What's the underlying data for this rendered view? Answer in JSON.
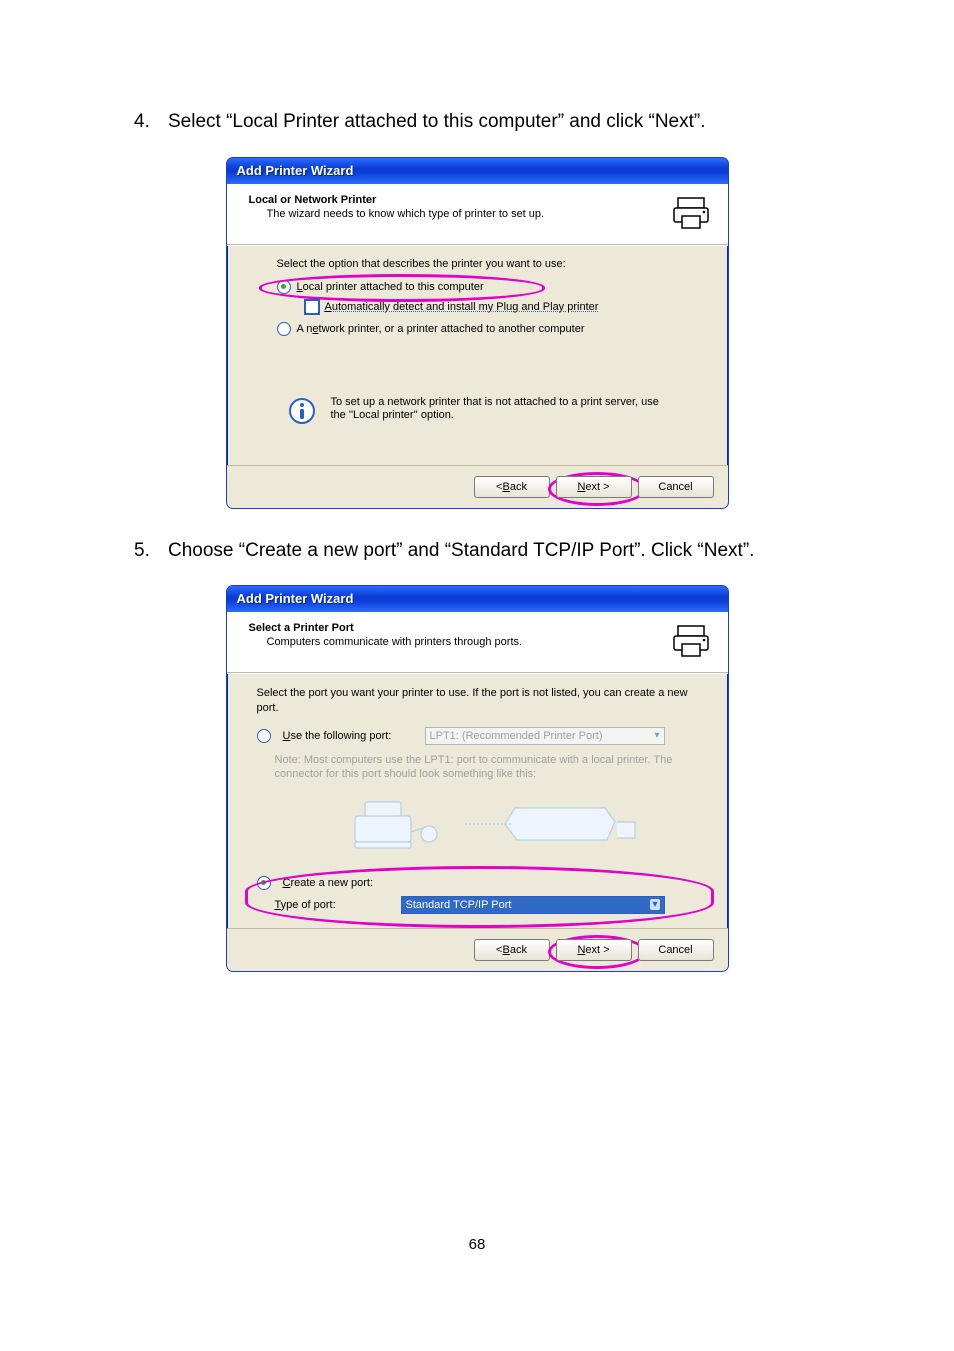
{
  "steps": {
    "s4": {
      "num": "4.",
      "text": "Select “Local Printer attached to this computer” and click “Next”."
    },
    "s5": {
      "num": "5.",
      "text": "Choose “Create a new port” and “Standard TCP/IP Port”. Click “Next”."
    }
  },
  "dialog1": {
    "title": "Add Printer Wizard",
    "header_title": "Local or Network Printer",
    "header_sub": "The wizard needs to know which type of printer to set up.",
    "prompt": "Select the option that describes the printer you want to use:",
    "opt_local_pre": "L",
    "opt_local_rest": "ocal printer attached to this computer",
    "opt_auto_pre": "A",
    "opt_auto_rest": "utomatically detect and install my Plug and Play printer",
    "opt_net_pre_a": "A n",
    "opt_net_u": "e",
    "opt_net_rest": "twork printer, or a printer attached to another computer",
    "info": "To set up a network printer that is not attached to a print server, use the ''Local printer'' option.",
    "back_pre": "< ",
    "back_u": "B",
    "back_rest": "ack",
    "next_u": "N",
    "next_rest": "ext >",
    "cancel": "Cancel"
  },
  "dialog2": {
    "title": "Add Printer Wizard",
    "header_title": "Select a Printer Port",
    "header_sub": "Computers communicate with printers through ports.",
    "prompt": "Select the port you want your printer to use.  If the port is not listed, you can create a new port.",
    "use_port_u": "U",
    "use_port_rest": "se the following port:",
    "use_port_value": "LPT1: (Recommended Printer Port)",
    "note": "Note: Most computers use the LPT1: port to communicate with a local printer. The connector for this port should look something like this:",
    "create_u": "C",
    "create_rest": "reate a new port:",
    "type_label_pre": "",
    "type_u": "T",
    "type_rest": "ype of port:",
    "type_value": "Standard TCP/IP Port",
    "back_pre": "< ",
    "back_u": "B",
    "back_rest": "ack",
    "next_u": "N",
    "next_rest": "ext >",
    "cancel": "Cancel"
  },
  "page_number": "68"
}
